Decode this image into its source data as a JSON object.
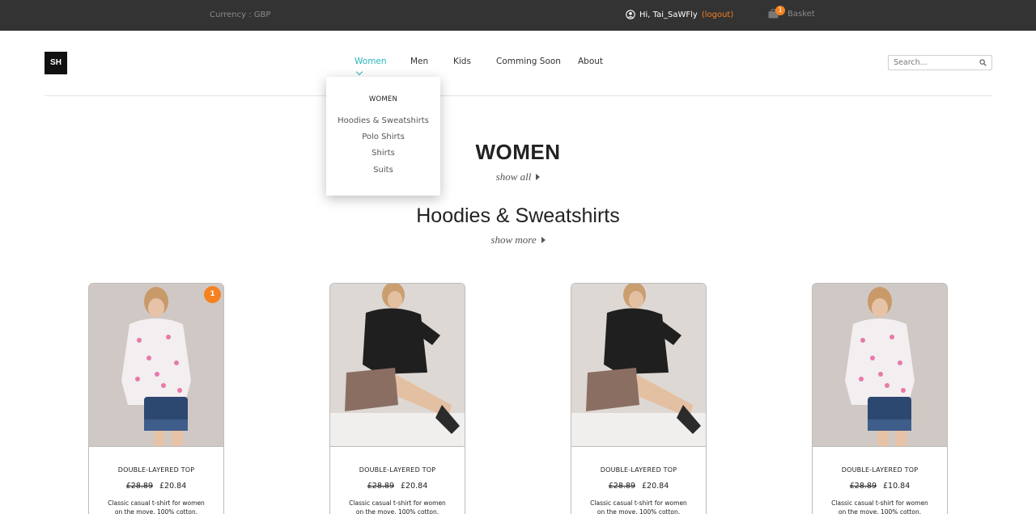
{
  "topbar": {
    "currency": "Currency : GBP",
    "greeting": "Hi, Tai_SaWFly",
    "logout": "logout",
    "basket_count": "1",
    "basket_label": "Basket"
  },
  "header": {
    "logo": "SH",
    "nav": [
      "Women",
      "Men",
      "Kids",
      "Comming Soon",
      "About"
    ],
    "search_placeholder": "Search..."
  },
  "dropdown": {
    "title": "WOMEN",
    "items": [
      "Hoodies & Sweatshirts",
      "Polo Shirts",
      "Shirts",
      "Suits"
    ]
  },
  "main": {
    "category_title": "WOMEN",
    "show_all": "show all",
    "section_title": "Hoodies & Sweatshirts",
    "show_more": "show more"
  },
  "products": [
    {
      "badge": "1",
      "title": "DOUBLE-LAYERED TOP",
      "old_price": "£28.89",
      "price": "£20.84",
      "desc1": "Classic casual t-shirt for women",
      "desc2": "on the move. 100% cotton.",
      "image": "pink-shirt"
    },
    {
      "badge": "",
      "title": "DOUBLE-LAYERED TOP",
      "old_price": "£28.89",
      "price": "£20.84",
      "desc1": "Classic casual t-shirt for women",
      "desc2": "on the move. 100% cotton.",
      "image": "black-sweater"
    },
    {
      "badge": "",
      "title": "DOUBLE-LAYERED TOP",
      "old_price": "£28.89",
      "price": "£20.84",
      "desc1": "Classic casual t-shirt for women",
      "desc2": "on the move. 100% cotton.",
      "image": "black-sweater"
    },
    {
      "badge": "",
      "title": "DOUBLE-LAYERED TOP",
      "old_price": "£28.89",
      "price": "£10.84",
      "desc1": "Classic casual t-shirt for women",
      "desc2": "on the move. 100% cotton.",
      "image": "pink-shirt"
    }
  ],
  "colors": {
    "topbar": "#333333",
    "accent": "#2bb5b8",
    "badge": "#f58220"
  }
}
